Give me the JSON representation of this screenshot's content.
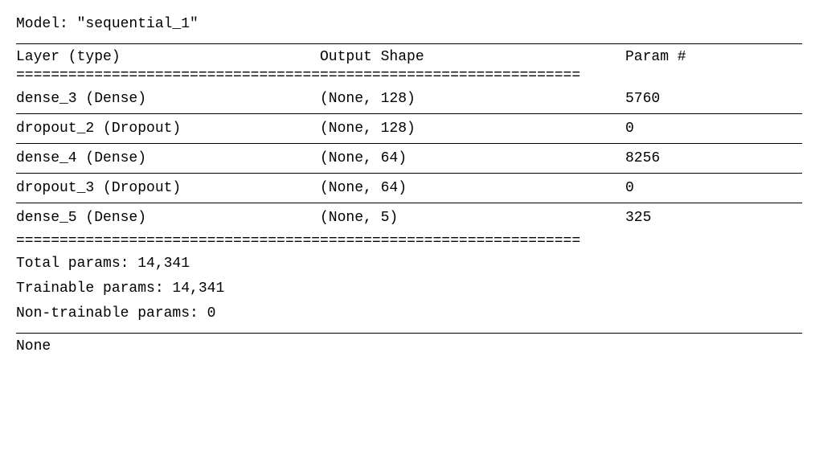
{
  "model_title": "Model: \"sequential_1\"",
  "header": {
    "col1": "Layer (type)",
    "col2": "Output Shape",
    "col3": "Param #"
  },
  "dline": "=================================================================",
  "layers": [
    {
      "name": "dense_3 (Dense)",
      "shape": "(None, 128)",
      "params": "5760"
    },
    {
      "name": "dropout_2 (Dropout)",
      "shape": "(None, 128)",
      "params": "0"
    },
    {
      "name": "dense_4 (Dense)",
      "shape": "(None, 64)",
      "params": "8256"
    },
    {
      "name": "dropout_3 (Dropout)",
      "shape": "(None, 64)",
      "params": "0"
    },
    {
      "name": "dense_5 (Dense)",
      "shape": "(None, 5)",
      "params": "325"
    }
  ],
  "footer": {
    "total": "Total params: 14,341",
    "trainable": "Trainable params: 14,341",
    "nontrainable": "Non-trainable params: 0"
  },
  "none": "None",
  "chart_data": {
    "type": "table",
    "title": "Model: sequential_1",
    "columns": [
      "Layer (type)",
      "Output Shape",
      "Param #"
    ],
    "rows": [
      [
        "dense_3 (Dense)",
        "(None, 128)",
        5760
      ],
      [
        "dropout_2 (Dropout)",
        "(None, 128)",
        0
      ],
      [
        "dense_4 (Dense)",
        "(None, 64)",
        8256
      ],
      [
        "dropout_3 (Dropout)",
        "(None, 64)",
        0
      ],
      [
        "dense_5 (Dense)",
        "(None, 5)",
        325
      ]
    ],
    "totals": {
      "total_params": 14341,
      "trainable_params": 14341,
      "non_trainable_params": 0
    }
  }
}
